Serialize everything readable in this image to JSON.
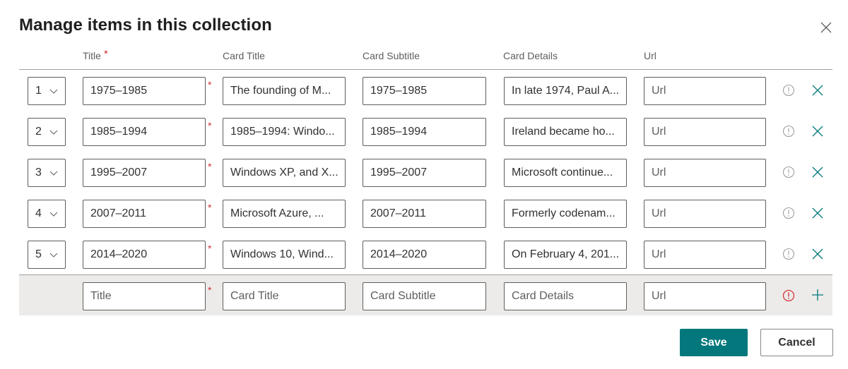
{
  "dialog": {
    "title": "Manage items in this collection",
    "close_icon": "close-icon"
  },
  "columns": {
    "title": "Title",
    "title_required_marker": "*",
    "card_title": "Card Title",
    "card_subtitle": "Card Subtitle",
    "card_details": "Card Details",
    "url": "Url"
  },
  "rows": [
    {
      "order": "1",
      "title": "1975–1985",
      "card_title": "The founding of M...",
      "card_subtitle": "1975–1985",
      "card_details": "In late 1974, Paul A...",
      "url": "",
      "url_placeholder": "Url"
    },
    {
      "order": "2",
      "title": "1985–1994",
      "card_title": "1985–1994: Windo...",
      "card_subtitle": "1985–1994",
      "card_details": "Ireland became ho...",
      "url": "",
      "url_placeholder": "Url"
    },
    {
      "order": "3",
      "title": "1995–2007",
      "card_title": "Windows XP, and X...",
      "card_subtitle": "1995–2007",
      "card_details": "Microsoft continue...",
      "url": "",
      "url_placeholder": "Url"
    },
    {
      "order": "4",
      "title": "2007–2011",
      "card_title": "Microsoft Azure, ...",
      "card_subtitle": "2007–2011",
      "card_details": "Formerly codenam...",
      "url": "",
      "url_placeholder": "Url"
    },
    {
      "order": "5",
      "title": "2014–2020",
      "card_title": "Windows 10, Wind...",
      "card_subtitle": "2014–2020",
      "card_details": "On February 4, 201...",
      "url": "",
      "url_placeholder": "Url"
    }
  ],
  "required_marker": "*",
  "new_row": {
    "title_placeholder": "Title",
    "card_title_placeholder": "Card Title",
    "card_subtitle_placeholder": "Card Subtitle",
    "card_details_placeholder": "Card Details",
    "url_placeholder": "Url"
  },
  "footer": {
    "save_label": "Save",
    "cancel_label": "Cancel"
  },
  "colors": {
    "accent": "#03787c",
    "required": "#d13438",
    "error": "#d13438",
    "info_gray": "#a19f9d"
  }
}
